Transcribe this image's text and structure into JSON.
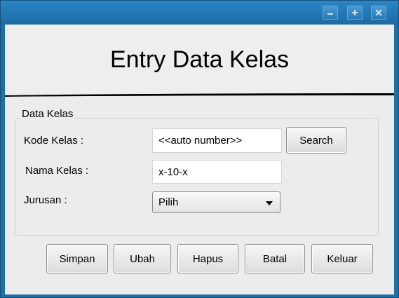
{
  "window": {
    "minimize_icon": "minimize-icon",
    "maximize_icon": "plus-icon",
    "close_icon": "close-icon"
  },
  "header": {
    "title": "Entry Data Kelas"
  },
  "form": {
    "group_title": "Data Kelas",
    "kode_kelas_label": "Kode Kelas :",
    "kode_kelas_value": "<<auto number>>",
    "search_label": "Search",
    "nama_kelas_label": "Nama Kelas :",
    "nama_kelas_value": "x-10-x",
    "jurusan_label": "Jurusan :",
    "jurusan_selected": "Pilih"
  },
  "actions": {
    "simpan": "Simpan",
    "ubah": "Ubah",
    "hapus": "Hapus",
    "batal": "Batal",
    "keluar": "Keluar"
  }
}
